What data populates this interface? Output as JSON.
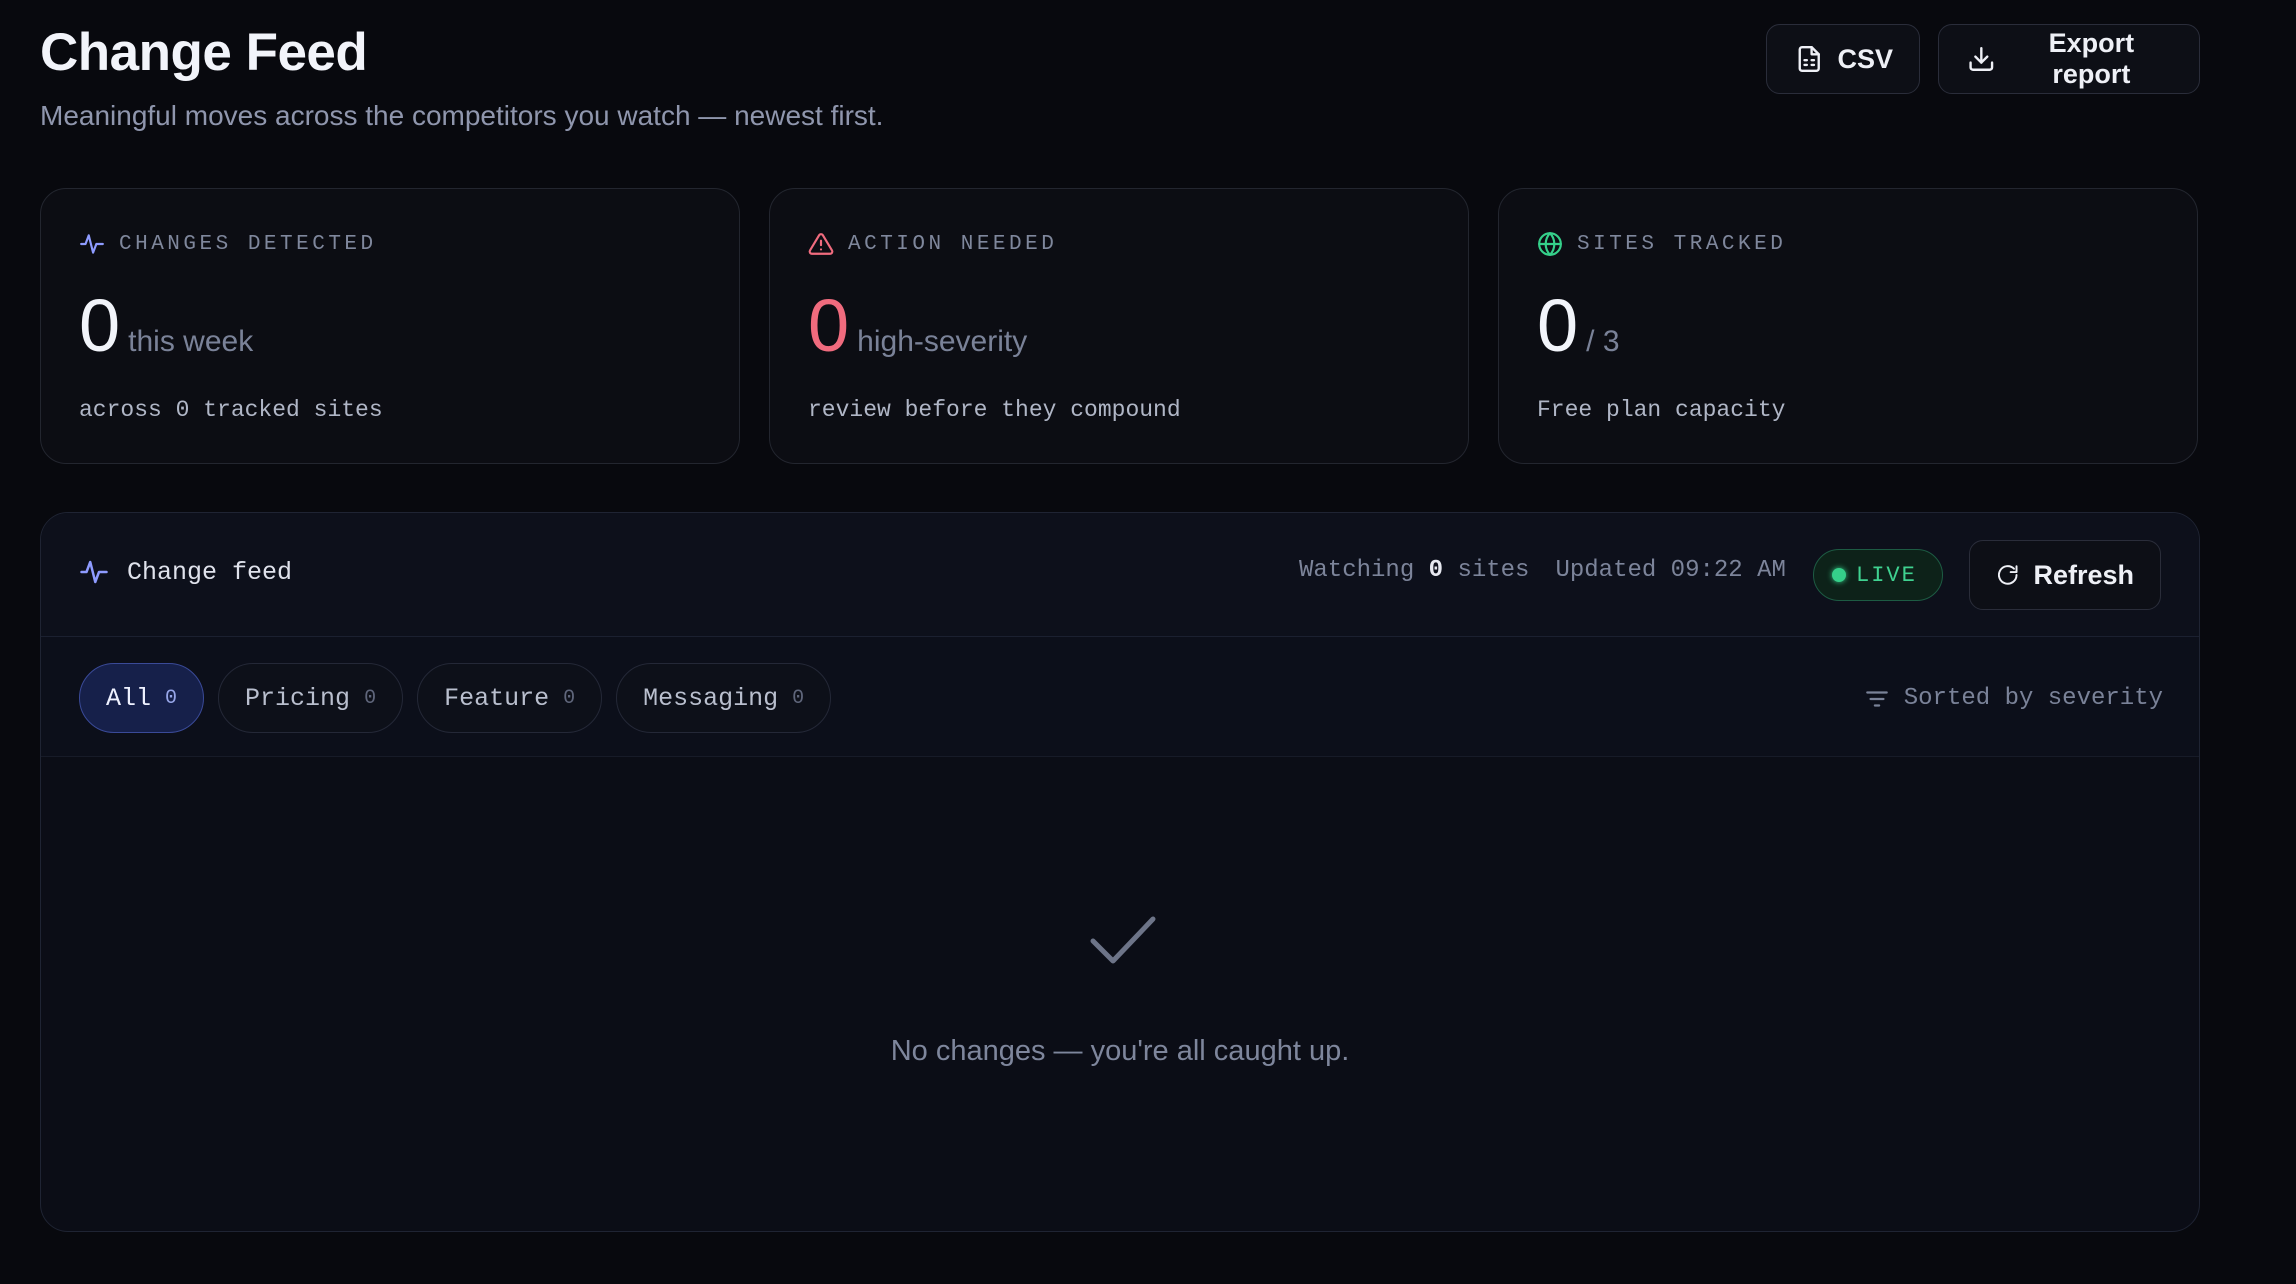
{
  "header": {
    "title": "Change Feed",
    "subtitle": "Meaningful moves across the competitors you watch — newest first.",
    "csv_label": "CSV",
    "export_label": "Export report"
  },
  "stats": [
    {
      "label": "CHANGES DETECTED",
      "icon": "pulse-icon",
      "value": "0",
      "unit": "this week",
      "desc": "across 0 tracked sites",
      "color": "#8e9bff"
    },
    {
      "label": "ACTION NEEDED",
      "icon": "warning-triangle-icon",
      "value": "0",
      "unit": "high-severity",
      "desc": "review before they compound",
      "color": "#f06b7e"
    },
    {
      "label": "SITES TRACKED",
      "icon": "globe-icon",
      "value": "0",
      "unit": "/ 3",
      "desc": "Free plan capacity",
      "color": "#35d08a"
    }
  ],
  "feed": {
    "title": "Change feed",
    "watching_prefix": "Watching",
    "watching_count": "0",
    "watching_suffix": "sites",
    "updated": "Updated 09:22 AM",
    "live_label": "LIVE",
    "refresh_label": "Refresh",
    "filters": [
      {
        "label": "All",
        "count": "0",
        "active": true
      },
      {
        "label": "Pricing",
        "count": "0",
        "active": false
      },
      {
        "label": "Feature",
        "count": "0",
        "active": false
      },
      {
        "label": "Messaging",
        "count": "0",
        "active": false
      }
    ],
    "sort_label": "Sorted by severity",
    "empty_text": "No changes — you're all caught up."
  },
  "colors": {
    "background": "#08090e",
    "accent": "#8e9bff",
    "danger": "#f06b7e",
    "success": "#35d08a"
  }
}
